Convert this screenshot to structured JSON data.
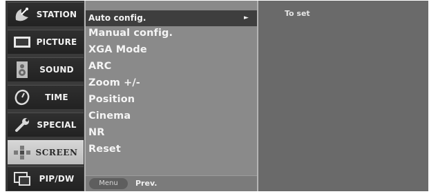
{
  "categories": [
    {
      "label": "STATION",
      "icon": "satellite-dish-icon",
      "active": false
    },
    {
      "label": "PICTURE",
      "icon": "monitor-icon",
      "active": false
    },
    {
      "label": "SOUND",
      "icon": "speaker-icon",
      "active": false
    },
    {
      "label": "TIME",
      "icon": "clock-icon",
      "active": false
    },
    {
      "label": "SPECIAL",
      "icon": "wrench-icon",
      "active": false
    },
    {
      "label": "SCREEN",
      "icon": "screen-adjust-icon",
      "active": true
    },
    {
      "label": "PIP/DW",
      "icon": "pip-icon",
      "active": false
    }
  ],
  "menu": {
    "items": [
      {
        "label": "Auto config.",
        "selected": true
      },
      {
        "label": "Manual config."
      },
      {
        "label": "XGA Mode"
      },
      {
        "label": "ARC"
      },
      {
        "label": "Zoom +/-"
      },
      {
        "label": "Position"
      },
      {
        "label": "Cinema"
      },
      {
        "label": "NR"
      },
      {
        "label": "Reset"
      }
    ],
    "arrow": "►"
  },
  "footer": {
    "menu_button": "Menu",
    "prev_label": "Prev."
  },
  "info": {
    "text": "To set"
  }
}
